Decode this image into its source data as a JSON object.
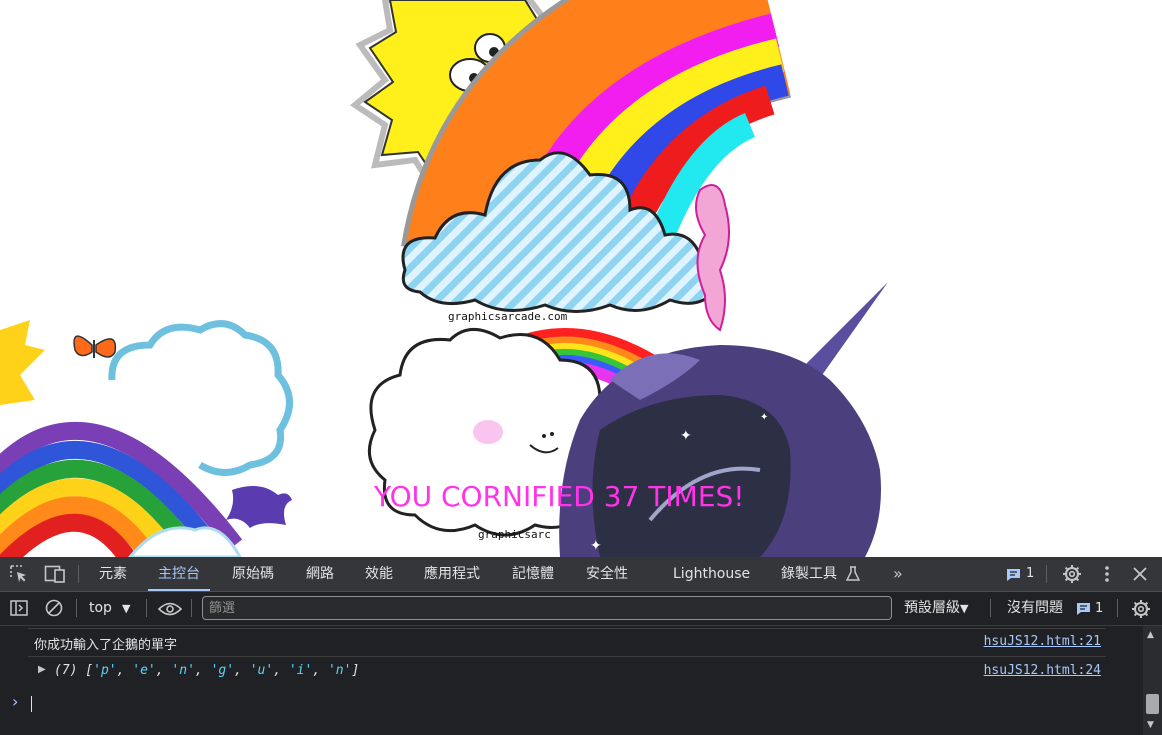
{
  "page": {
    "banner_text": "YOU CORNIFIED 37 TIMES!",
    "watermark_top": "graphicsarcade.com",
    "watermark_bottom": "graphicsarc",
    "colors": {
      "banner": "#ff33e8"
    }
  },
  "devtools": {
    "tabs": [
      {
        "label": "元素"
      },
      {
        "label": "主控台"
      },
      {
        "label": "原始碼"
      },
      {
        "label": "網路"
      },
      {
        "label": "效能"
      },
      {
        "label": "應用程式"
      },
      {
        "label": "記憶體"
      },
      {
        "label": "安全性"
      },
      {
        "label": "Lighthouse"
      },
      {
        "label": "錄製工具"
      }
    ],
    "active_tab": "主控台",
    "more_tabs_icon": "double-chevron-right-icon",
    "message_count": "1",
    "toolbar": {
      "context": "top",
      "filter_placeholder": "篩選",
      "levels": "預設層級",
      "issues": "沒有問題",
      "issues_count": "1"
    },
    "console": {
      "messages": [
        {
          "text": "你成功輸入了企鵝的單字",
          "source": "hsuJS12.html:21"
        },
        {
          "prefix": "(7)",
          "items": [
            "'p'",
            "'e'",
            "'n'",
            "'g'",
            "'u'",
            "'i'",
            "'n'"
          ],
          "source": "hsuJS12.html:24"
        }
      ],
      "prompt": "›"
    },
    "colors": {
      "panel": "#202124",
      "tabbar": "#35363a",
      "accent": "#a8c7fa",
      "string": "#5cd5fb"
    }
  }
}
